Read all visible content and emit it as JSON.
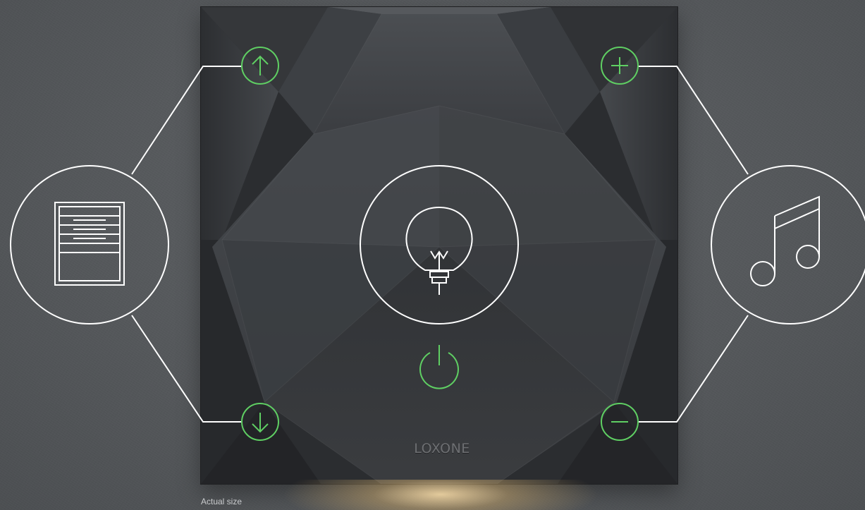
{
  "device": {
    "brand": "LOXONE",
    "caption": "Actual size"
  },
  "controls": {
    "blinds": {
      "icon": "window-blinds-icon",
      "up_icon": "arrow-up-icon",
      "down_icon": "arrow-down-icon"
    },
    "lighting": {
      "icon": "light-bulb-icon",
      "toggle_icon": "power-icon"
    },
    "music": {
      "icon": "music-note-icon",
      "plus_icon": "plus-icon",
      "minus_icon": "minus-icon"
    }
  },
  "colors": {
    "accent_green": "#5fcf63",
    "line_white": "#ffffff",
    "panel": "#2a2c2f",
    "wall": "#55585b"
  }
}
